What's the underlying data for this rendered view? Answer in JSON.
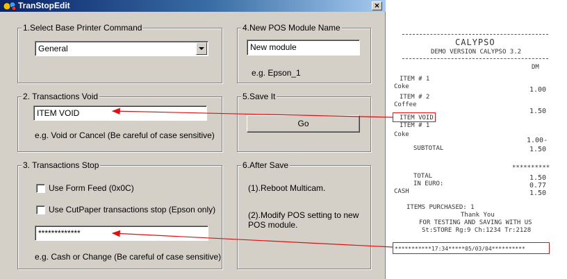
{
  "window": {
    "title": "TranStopEdit",
    "close_glyph": "×"
  },
  "section1": {
    "title": "1.Select Base Printer Command",
    "selected": "General"
  },
  "section2": {
    "title": "2. Transactions Void",
    "value": "ITEM VOID",
    "hint": "e.g. Void or Cancel (Be careful of case sensitive)"
  },
  "section3": {
    "title": "3. Transactions Stop",
    "option1": "Use Form Feed (0x0C)",
    "option2": "Use CutPaper transactions stop (Epson only)",
    "value": "*************",
    "hint": "e.g. Cash or Change (Be careful of case sensitive)"
  },
  "section4": {
    "title": "4.New POS Module Name",
    "value": "New module",
    "hint": "e.g. Epson_1"
  },
  "section5": {
    "title": "5.Save It",
    "button": "Go"
  },
  "section6": {
    "title": "6.After Save",
    "step1": "(1).Reboot Multicam.",
    "step2a": "(2).Modify POS setting to new",
    "step2b": "POS module."
  },
  "receipt": {
    "brand": "CALYPSO",
    "version": "DEMO VERSION CALYPSO 3.2",
    "currency": "DM",
    "item1": "ITEM # 1",
    "coke": "Coke",
    "coke_price": "1.00",
    "item2": "ITEM # 2",
    "coffee": "Coffee",
    "coffee_price": "1.50",
    "void": "ITEM VOID",
    "item3": "ITEM # 1",
    "coke2": "Coke",
    "coke2_price": "1.00-",
    "subtotal": "SUBTOTAL",
    "subtotal_val": "1.50",
    "stars": "**********",
    "total": "TOTAL",
    "total_val": "1.50",
    "euro": "IN EURO:",
    "euro_val": "0.77",
    "cash": "CASH",
    "cash_val": "1.50",
    "purchased": "ITEMS PURCHASED: 1",
    "thanks": "Thank You",
    "testing": "FOR TESTING AND SAVING WITH US",
    "store": "St:STORE Rg:9 Ch:1234 Tr:2128",
    "stop_line": "***********17:34*****05/03/04**********"
  },
  "colors": {
    "annotation": "#dd1111",
    "titlebar": "#0a246a"
  }
}
